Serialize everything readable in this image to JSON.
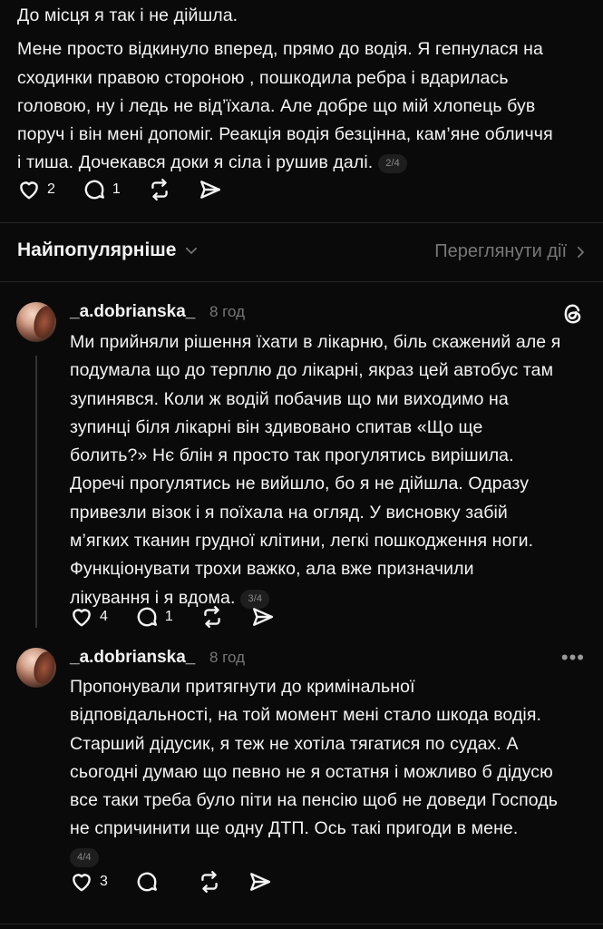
{
  "top_post": {
    "line1": "До місця я так і не дійшла.",
    "body_lines": [
      "Мене просто відкинуло вперед, прямо до водія. Я гепнулася на",
      "сходинки правою стороною , пошкодила ребра і вдарилась",
      "головою, ну і ледь не від’їхала. Але добре що мій хлопець був",
      "поруч і він мені допоміг. Реакція водія безцінна, кам’яне обличчя",
      "і тиша. Дочекався доки я сіла і рушив далі."
    ],
    "pager": "2/4",
    "likes": "2",
    "replies": "1"
  },
  "sort_bar": {
    "label": "Найпопулярніше",
    "chevron": "chevron-down-icon",
    "view_activity": "Переглянути дії"
  },
  "comments": [
    {
      "username": "_a.dobrianska_",
      "time": "8 год",
      "lines": [
        "Ми прийняли рішення їхати в лікарню, біль скажений але я",
        "подумала що до терплю до лікарні, якраз цей автобус там",
        "зупинявся. Коли ж водій побачив що ми виходимо на",
        "зупинці біля лікарні він здивовано спитав «Що ще",
        "болить?» Нє блін я просто так прогулятись вирішила.",
        "Доречі прогулятись не вийшло, бо я не дійшла. Одразу",
        "привезли візок і я поїхала на огляд. У висновку забій",
        "м’ягких тканин грудної клітини, легкі пошкодження ноги.",
        "Функціонувати трохи важко, ала вже призначили",
        "лікування і я вдома."
      ],
      "pager": "3/4",
      "likes": "4",
      "replies": "1"
    },
    {
      "username": "_a.dobrianska_",
      "time": "8 год",
      "lines": [
        "Пропонували притягнути до кримінальної",
        "відповідальності, на той момент мені стало шкода водія.",
        "Старший дідусик, я теж не хотіла тягатися по судах. А",
        "сьогодні думаю що певно не я остатня і можливо б дідусю",
        "все таки треба було піти на пенсію щоб не доведи Господь",
        "не спричинити ще одну ДТП. Ось такі пригоди в мене."
      ],
      "pager": "4/4",
      "likes": "3",
      "replies": ""
    }
  ]
}
